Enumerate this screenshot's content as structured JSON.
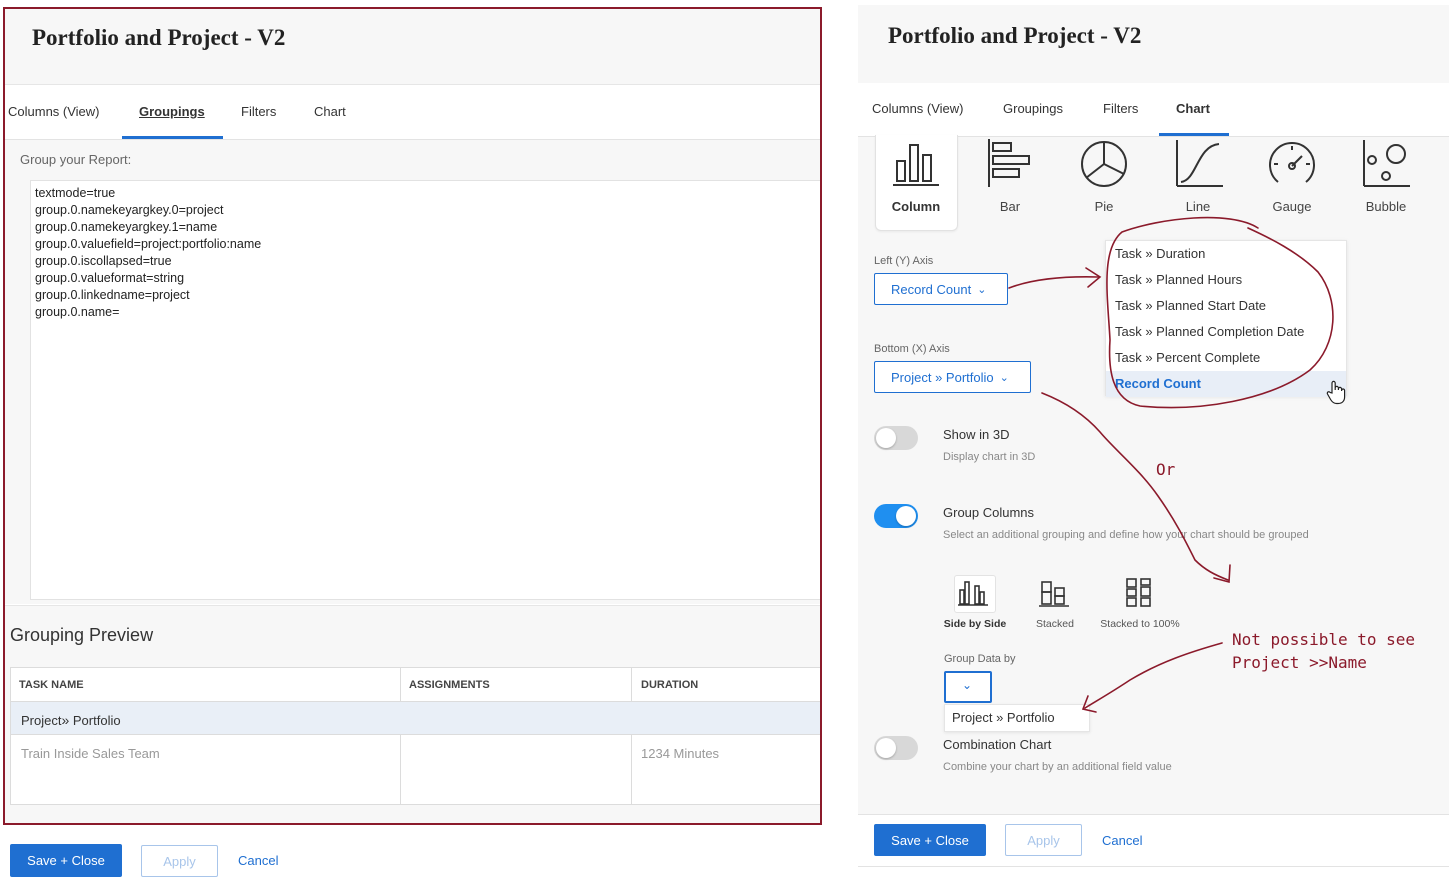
{
  "left": {
    "title": "Portfolio and Project - V2",
    "tabs": [
      "Columns (View)",
      "Groupings",
      "Filters",
      "Chart"
    ],
    "active_tab": "Groupings",
    "group_label": "Group your Report:",
    "code_lines": [
      "textmode=true",
      "group.0.namekeyargkey.0=project",
      "group.0.namekeyargkey.1=name",
      "group.0.valuefield=project:portfolio:name",
      "group.0.iscollapsed=true",
      "group.0.valueformat=string",
      "group.0.linkedname=project",
      "group.0.name="
    ],
    "preview_title": "Grouping Preview",
    "table_headers": [
      "TASK NAME",
      "ASSIGNMENTS",
      "DURATION"
    ],
    "group_row": {
      "part1": "Project",
      "sep": "»",
      "part2": "Portfolio"
    },
    "data_row": {
      "task": "Train Inside Sales Team",
      "assignments": "",
      "duration": "1234 Minutes"
    },
    "footer": {
      "save": "Save + Close",
      "apply": "Apply",
      "cancel": "Cancel"
    }
  },
  "right": {
    "title": "Portfolio and Project - V2",
    "tabs": [
      "Columns (View)",
      "Groupings",
      "Filters",
      "Chart"
    ],
    "active_tab": "Chart",
    "chart_types": [
      {
        "label": "Column",
        "icon": "column-chart-icon"
      },
      {
        "label": "Bar",
        "icon": "bar-chart-icon"
      },
      {
        "label": "Pie",
        "icon": "pie-chart-icon"
      },
      {
        "label": "Line",
        "icon": "line-chart-icon"
      },
      {
        "label": "Gauge",
        "icon": "gauge-chart-icon"
      },
      {
        "label": "Bubble",
        "icon": "bubble-chart-icon"
      }
    ],
    "selected_chart": "Column",
    "left_axis_label": "Left (Y) Axis",
    "left_axis_value": "Record Count",
    "bottom_axis_label": "Bottom (X) Axis",
    "bottom_axis_value": "Project » Portfolio",
    "y_axis_options": [
      "Task » Duration",
      "Task » Planned Hours",
      "Task » Planned Start Date",
      "Task » Planned Completion Date",
      "Task » Percent Complete",
      "Record Count"
    ],
    "y_axis_selected": "Record Count",
    "show3d": {
      "title": "Show in 3D",
      "desc": "Display chart in 3D",
      "on": false
    },
    "group_columns": {
      "title": "Group Columns",
      "desc": "Select an additional grouping and define how your chart should be grouped",
      "on": true
    },
    "group_styles": [
      "Side by Side",
      "Stacked",
      "Stacked to 100%"
    ],
    "group_style_selected": "Side by Side",
    "group_data_by_label": "Group Data by",
    "group_data_by_options": [
      "Project » Portfolio"
    ],
    "combination": {
      "title": "Combination Chart",
      "desc": "Combine your chart by an additional field value",
      "on": false
    },
    "footer": {
      "save": "Save + Close",
      "apply": "Apply",
      "cancel": "Cancel"
    }
  },
  "annotations": {
    "or": "Or",
    "note_line1": "Not possible to see",
    "note_line2": "Project >>Name"
  },
  "colors": {
    "accent": "#1f6fd1",
    "annotation": "#8b1a2b",
    "toggle_on": "#1f8ff0"
  }
}
